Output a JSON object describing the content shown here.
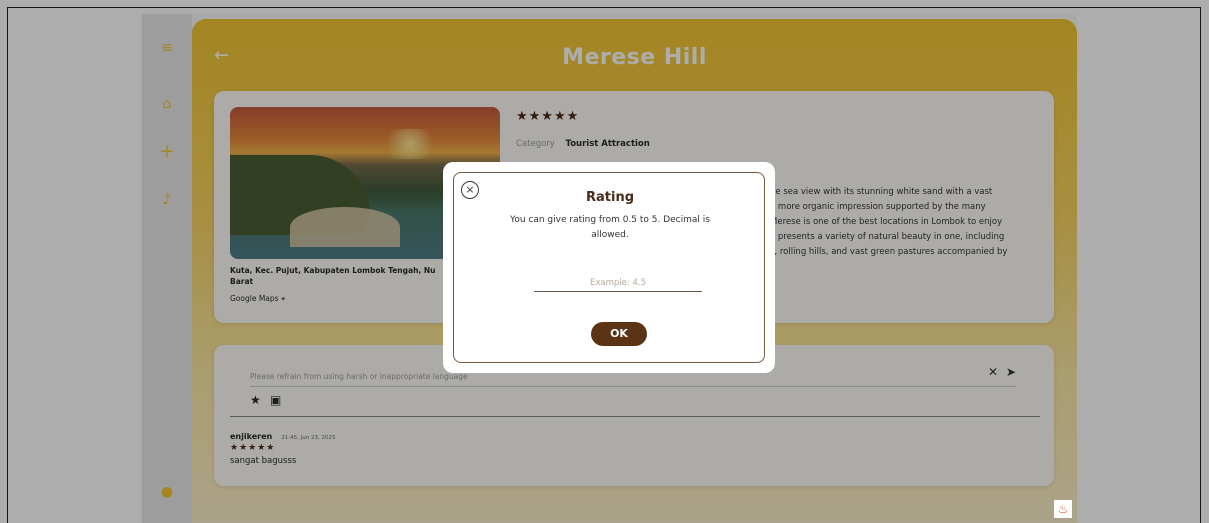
{
  "header": {
    "title": "Merese Hill",
    "back_icon": "←"
  },
  "sidebar": {
    "icons": [
      "menu-icon",
      "home-icon",
      "add-icon",
      "bell-icon",
      "user-icon"
    ],
    "accent": "#f4c430"
  },
  "detail": {
    "rating_stars": "★★★★★",
    "category_label": "Category",
    "category_value": "Tourist Attraction",
    "address_line1": "Kuta, Kec. Pujut, Kabupaten Lombok Tengah, Nu",
    "address_line2": "Barat",
    "maps_label": "Google Maps",
    "description_lines": [
      "he sea view with its stunning white sand with a vast",
      "a more organic impression supported by the many",
      "Merese is one of the best locations in Lombok to enjoy",
      "a presents a variety of natural beauty in one, including",
      "s, rolling hills, and vast green pastures accompanied by"
    ]
  },
  "comments": {
    "input_placeholder": "Please refrain from using harsh or inappropriate language",
    "items": [
      {
        "user": "enjikeren",
        "timestamp": "21:45, Jun 23, 2025",
        "stars": "★★★★★",
        "text": "sangat bagusss"
      }
    ]
  },
  "dialog": {
    "title": "Rating",
    "message": "You can give rating from 0.5 to 5. Decimal is allowed.",
    "input_placeholder": "Example: 4.5",
    "ok_label": "OK",
    "close_label": "×"
  },
  "colors": {
    "brand_brown": "#5b3315",
    "hero_yellow": "#f1c430"
  }
}
